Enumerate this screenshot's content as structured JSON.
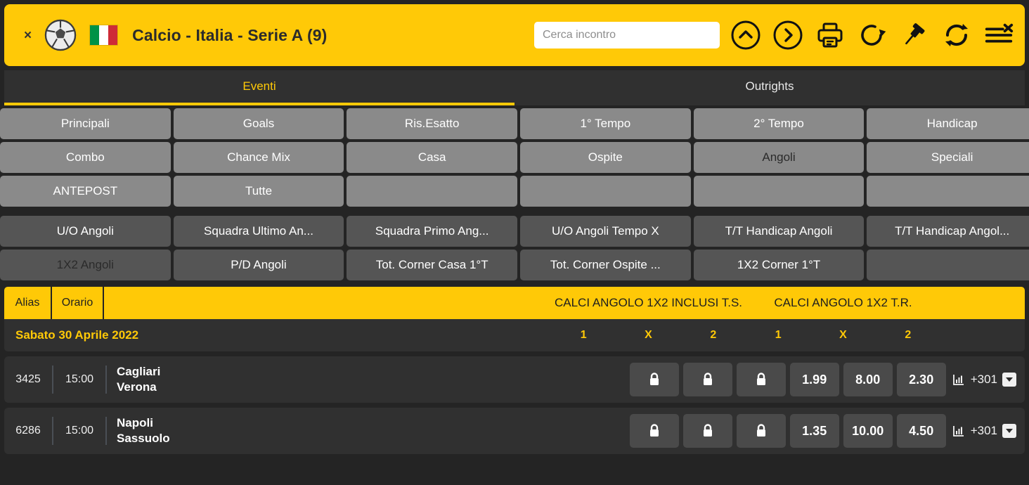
{
  "colors": {
    "brand": "#FFC907",
    "bg": "#242424",
    "panel": "#303030",
    "btn_primary": "#8a8a8a",
    "btn_secondary": "#555555",
    "odds_cell": "#4a4a4a"
  },
  "header": {
    "close_label": "×",
    "title": "Calcio - Italia - Serie A (9)",
    "sport_icon": "soccer-ball-icon",
    "flag_icon": "italy-flag-icon",
    "search": {
      "value": "",
      "placeholder": "Cerca incontro"
    },
    "icons": [
      {
        "name": "collapse-up-circle-icon",
        "label": "Comprimi"
      },
      {
        "name": "next-right-circle-icon",
        "label": "Avanti"
      },
      {
        "name": "print-icon",
        "label": "Stampa"
      },
      {
        "name": "reload-icon",
        "label": "Ricarica"
      },
      {
        "name": "pin-icon",
        "label": "Fissa"
      },
      {
        "name": "refresh-sync-icon",
        "label": "Aggiorna"
      },
      {
        "name": "list-remove-icon",
        "label": "Rimuovi lista"
      }
    ]
  },
  "tabs": [
    {
      "label": "Eventi",
      "active": true
    },
    {
      "label": "Outrights",
      "active": false
    }
  ],
  "market_filters": {
    "primary": [
      {
        "label": "Principali",
        "active": false
      },
      {
        "label": "Goals",
        "active": false
      },
      {
        "label": "Ris.Esatto",
        "active": false
      },
      {
        "label": "1° Tempo",
        "active": false
      },
      {
        "label": "2° Tempo",
        "active": false
      },
      {
        "label": "Handicap",
        "active": false
      },
      {
        "label": "Combo",
        "active": false
      },
      {
        "label": "Chance Mix",
        "active": false
      },
      {
        "label": "Casa",
        "active": false
      },
      {
        "label": "Ospite",
        "active": false
      },
      {
        "label": "Angoli",
        "active": true
      },
      {
        "label": "Speciali",
        "active": false
      },
      {
        "label": "ANTEPOST",
        "active": false
      },
      {
        "label": "Tutte",
        "active": false
      }
    ],
    "secondary": [
      {
        "label": "U/O Angoli",
        "active": false
      },
      {
        "label": "Squadra Ultimo An...",
        "active": false
      },
      {
        "label": "Squadra Primo Ang...",
        "active": false
      },
      {
        "label": "U/O Angoli Tempo X",
        "active": false
      },
      {
        "label": "T/T Handicap Angoli",
        "active": false
      },
      {
        "label": "T/T Handicap Angol...",
        "active": false
      },
      {
        "label": "1X2 Angoli",
        "active": true
      },
      {
        "label": "P/D Angoli",
        "active": false
      },
      {
        "label": "Tot. Corner Casa 1°T",
        "active": false
      },
      {
        "label": "Tot. Corner Ospite ...",
        "active": false
      },
      {
        "label": "1X2 Corner 1°T",
        "active": false
      }
    ]
  },
  "table": {
    "columns": {
      "alias": "Alias",
      "orario": "Orario"
    },
    "markets": [
      {
        "title": "CALCI ANGOLO 1X2 INCLUSI T.S.",
        "outcomes": [
          "1",
          "X",
          "2"
        ]
      },
      {
        "title": "CALCI ANGOLO 1X2 T.R.",
        "outcomes": [
          "1",
          "X",
          "2"
        ]
      }
    ],
    "date_group": "Sabato 30 Aprile 2022",
    "rows": [
      {
        "alias": "3425",
        "time": "15:00",
        "home": "Cagliari",
        "away": "Verona",
        "odds": [
          {
            "locked": true
          },
          {
            "locked": true
          },
          {
            "locked": true
          },
          {
            "value": "1.99"
          },
          {
            "value": "8.00"
          },
          {
            "value": "2.30"
          }
        ],
        "more_count": "+301",
        "more_icon": "bar-chart-icon"
      },
      {
        "alias": "6286",
        "time": "15:00",
        "home": "Napoli",
        "away": "Sassuolo",
        "odds": [
          {
            "locked": true
          },
          {
            "locked": true
          },
          {
            "locked": true
          },
          {
            "value": "1.35"
          },
          {
            "value": "10.00"
          },
          {
            "value": "4.50"
          }
        ],
        "more_count": "+301",
        "more_icon": "bar-chart-icon"
      }
    ]
  }
}
